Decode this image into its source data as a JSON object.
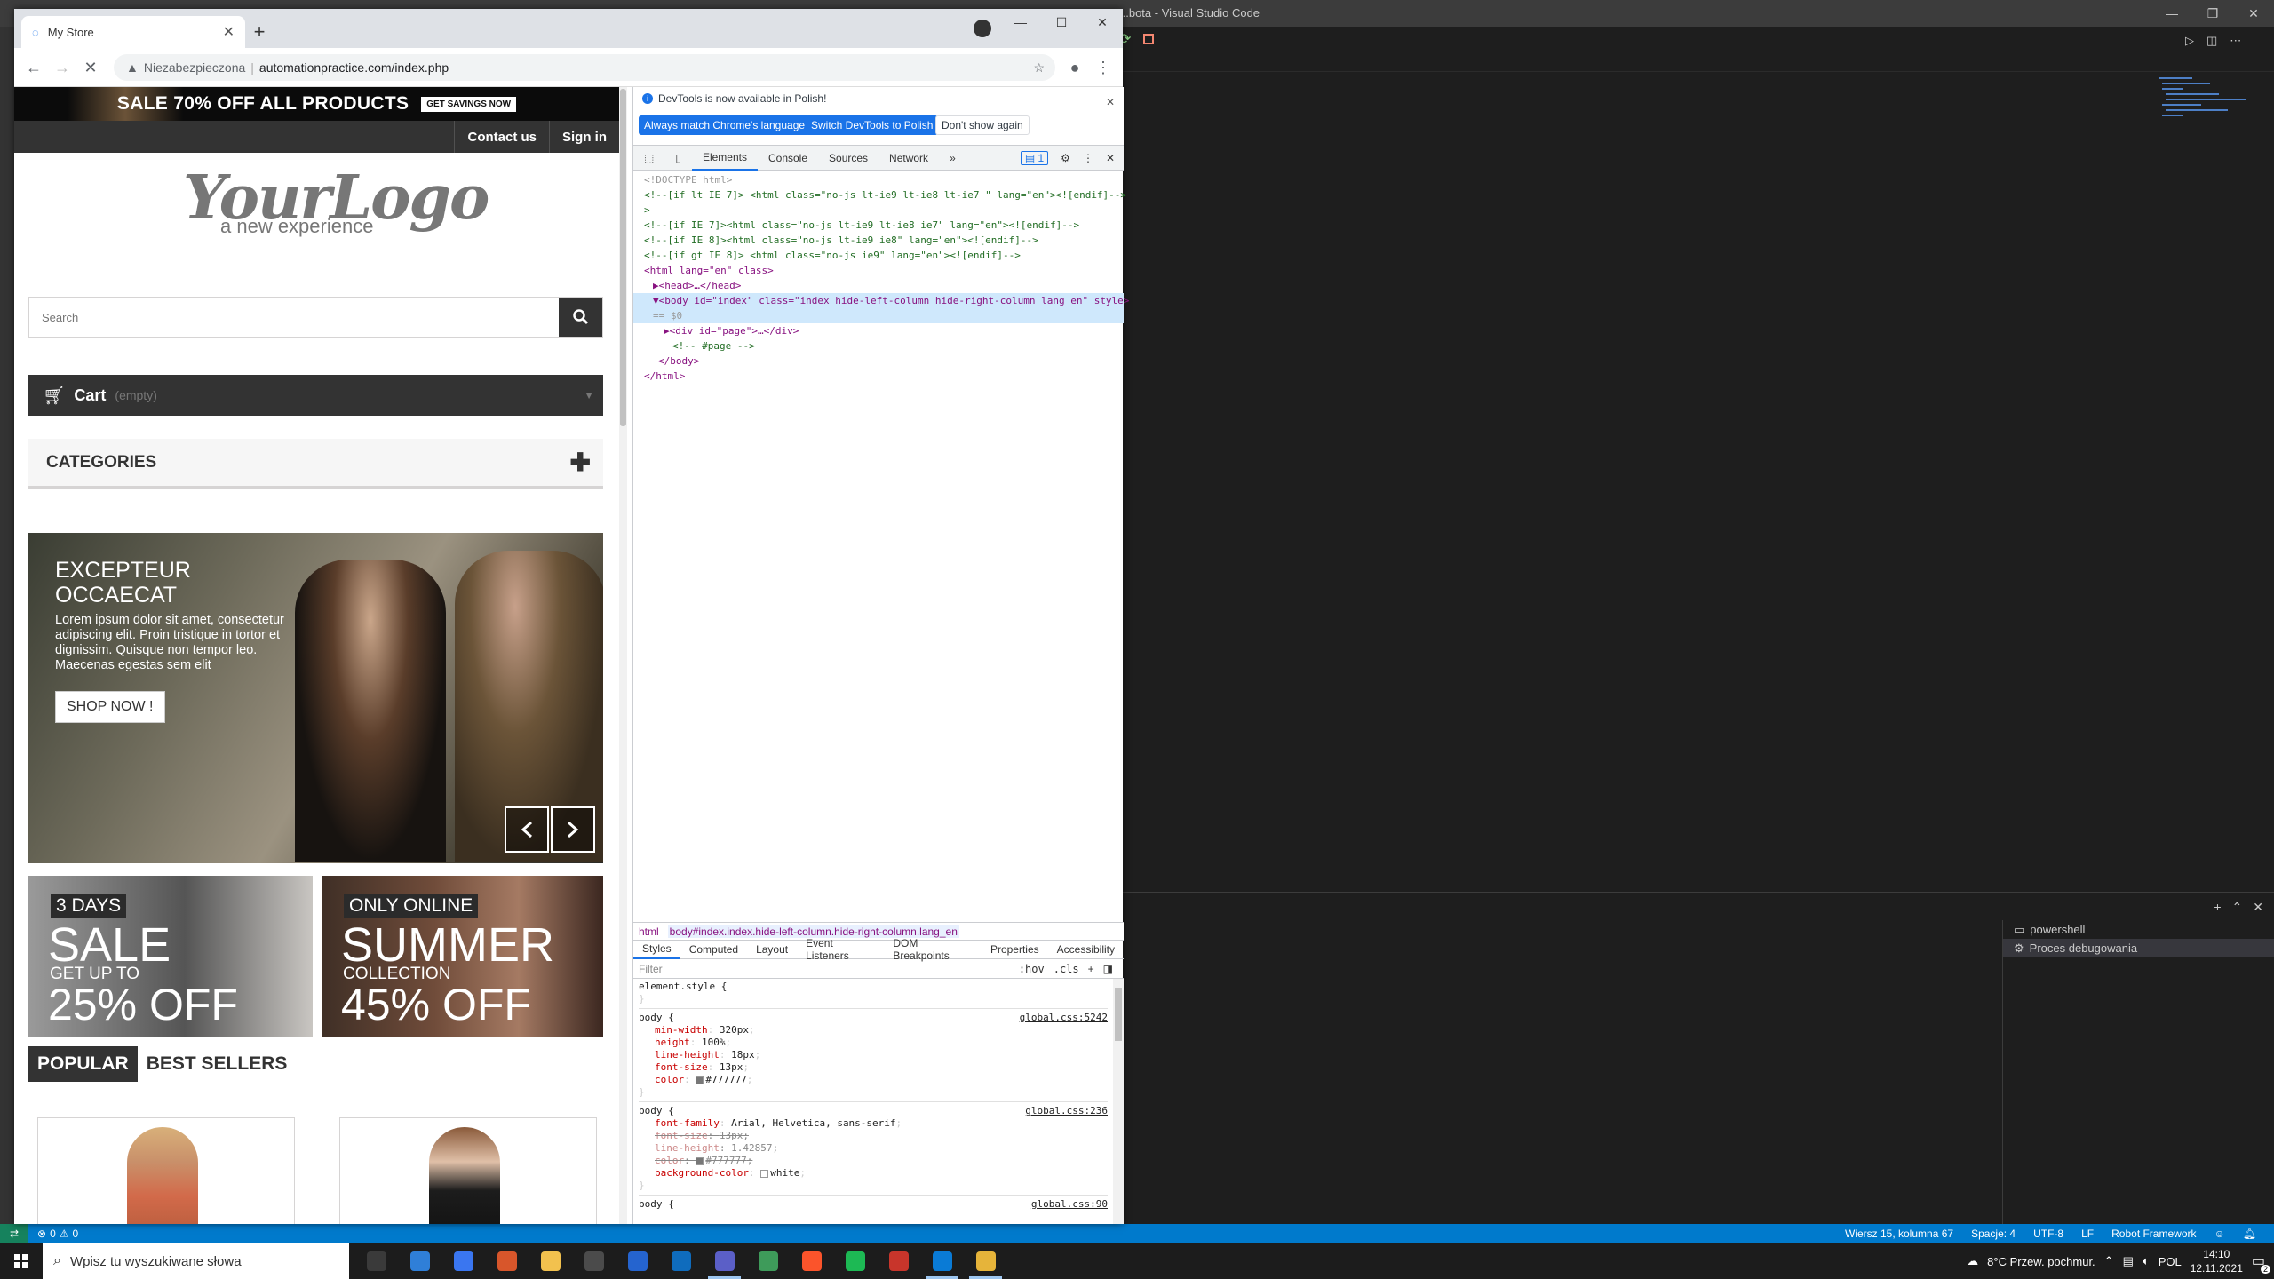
{
  "vscode": {
    "title": "...bota - Visual Studio Code",
    "terminals": [
      "powershell",
      "Proces debugowania"
    ],
    "status": {
      "errors": "0",
      "warnings": "0",
      "position": "Wiersz 15, kolumna 67",
      "spaces": "Spacje: 4",
      "encoding": "UTF-8",
      "eol": "LF",
      "language": "Robot Framework"
    }
  },
  "taskbar": {
    "search_placeholder": "Wpisz tu wyszukiwane słowa",
    "weather": "8°C  Przew. pochmur.",
    "lang": "POL",
    "time": "14:10",
    "date": "12.11.2021",
    "notif_count": "2",
    "apps": [
      {
        "name": "task-view",
        "color": "#3a3a3a"
      },
      {
        "name": "mail",
        "color": "#2f7fd8"
      },
      {
        "name": "signal",
        "color": "#3a76f0"
      },
      {
        "name": "chrome-dev",
        "color": "#d8562b"
      },
      {
        "name": "file-explorer",
        "color": "#f2c14e"
      },
      {
        "name": "remote-desktop",
        "color": "#4b4b4b"
      },
      {
        "name": "todo",
        "color": "#2564cf"
      },
      {
        "name": "outlook",
        "color": "#0f6cbd"
      },
      {
        "name": "teams",
        "color": "#5b5fc7"
      },
      {
        "name": "app-green",
        "color": "#3e9b5a"
      },
      {
        "name": "brave",
        "color": "#fb542b"
      },
      {
        "name": "spotify",
        "color": "#1db954"
      },
      {
        "name": "app-red",
        "color": "#c8352b"
      },
      {
        "name": "vscode",
        "color": "#0a7bd6"
      },
      {
        "name": "chrome",
        "color": "#e6b43a"
      }
    ]
  },
  "chrome": {
    "tab_title": "My Store",
    "url_warning": "Niezabezpieczona",
    "url": "automationpractice.com/index.php"
  },
  "store": {
    "banner_text": "SALE 70% OFF ALL PRODUCTS",
    "banner_button": "GET SAVINGS NOW",
    "nav": [
      "Contact us",
      "Sign in"
    ],
    "logo_main": "YourLogo",
    "logo_sub": "a new experience",
    "search_placeholder": "Search",
    "cart_label": "Cart",
    "cart_status": "(empty)",
    "categories": "CATEGORIES",
    "slide_title": "EXCEPTEUR OCCAECAT",
    "slide_text": "Lorem ipsum dolor sit amet, consectetur adipiscing elit. Proin tristique in tortor et dignissim. Quisque non tempor leo. Maecenas egestas sem elit",
    "slide_button": "SHOP NOW !",
    "promo1": {
      "badge": "3 DAYS",
      "big": "SALE",
      "small": "GET UP TO",
      "pct": "25% OFF"
    },
    "promo2": {
      "badge": "ONLY ONLINE",
      "big": "SUMMER",
      "small": "COLLECTION",
      "pct": "45% OFF"
    },
    "tabs": [
      "POPULAR",
      "BEST SELLERS"
    ]
  },
  "devtools": {
    "info_text": "DevTools is now available in Polish!",
    "btn_match": "Always match Chrome's language",
    "btn_switch": "Switch DevTools to Polish",
    "btn_dismiss": "Don't show again",
    "tabs": [
      "Elements",
      "Console",
      "Sources",
      "Network"
    ],
    "issues": "1",
    "breadcrumb": [
      "html",
      "body#index.index.hide-left-column.hide-right-column.lang_en"
    ],
    "subtabs": [
      "Styles",
      "Computed",
      "Layout",
      "Event Listeners",
      "DOM Breakpoints",
      "Properties",
      "Accessibility"
    ],
    "filter_placeholder": "Filter",
    "filter_tools": [
      ":hov",
      ".cls",
      "+"
    ],
    "dom_lines": [
      "<!DOCTYPE html>",
      "<!--[if lt IE 7]> <html class=\"no-js lt-ie9 lt-ie8 lt-ie7 \" lang=\"en\"><![endif]-->",
      "<!--[if IE 7]><html class=\"no-js lt-ie9 lt-ie8 ie7\" lang=\"en\"><![endif]-->",
      "<!--[if IE 8]><html class=\"no-js lt-ie9 ie8\" lang=\"en\"><![endif]-->",
      "<!--[if gt IE 8]> <html class=\"no-js ie9\" lang=\"en\"><![endif]-->",
      "<html lang=\"en\" class>",
      "▶<head>…</head>",
      "▼<body id=\"index\" class=\"index hide-left-column hide-right-column lang_en\" style>",
      "== $0",
      "▶<div id=\"page\">…</div>",
      "<!-- #page -->",
      "</body>",
      "</html>"
    ],
    "styles": {
      "element_style": "element.style {",
      "rule1_src": "global.css:5242",
      "rule1_props": [
        [
          "min-width",
          "320px"
        ],
        [
          "height",
          "100%"
        ],
        [
          "line-height",
          "18px"
        ],
        [
          "font-size",
          "13px"
        ],
        [
          "color",
          "#777777"
        ]
      ],
      "rule2_src": "global.css:236",
      "rule2_props": [
        [
          "font-family",
          "Arial, Helvetica, sans-serif"
        ],
        [
          "font-size",
          "13px"
        ],
        [
          "line-height",
          "1.42857"
        ],
        [
          "color",
          "#777777"
        ],
        [
          "background-color",
          "white"
        ]
      ],
      "rule3_src": "global.css:90",
      "selector": "body {"
    }
  }
}
